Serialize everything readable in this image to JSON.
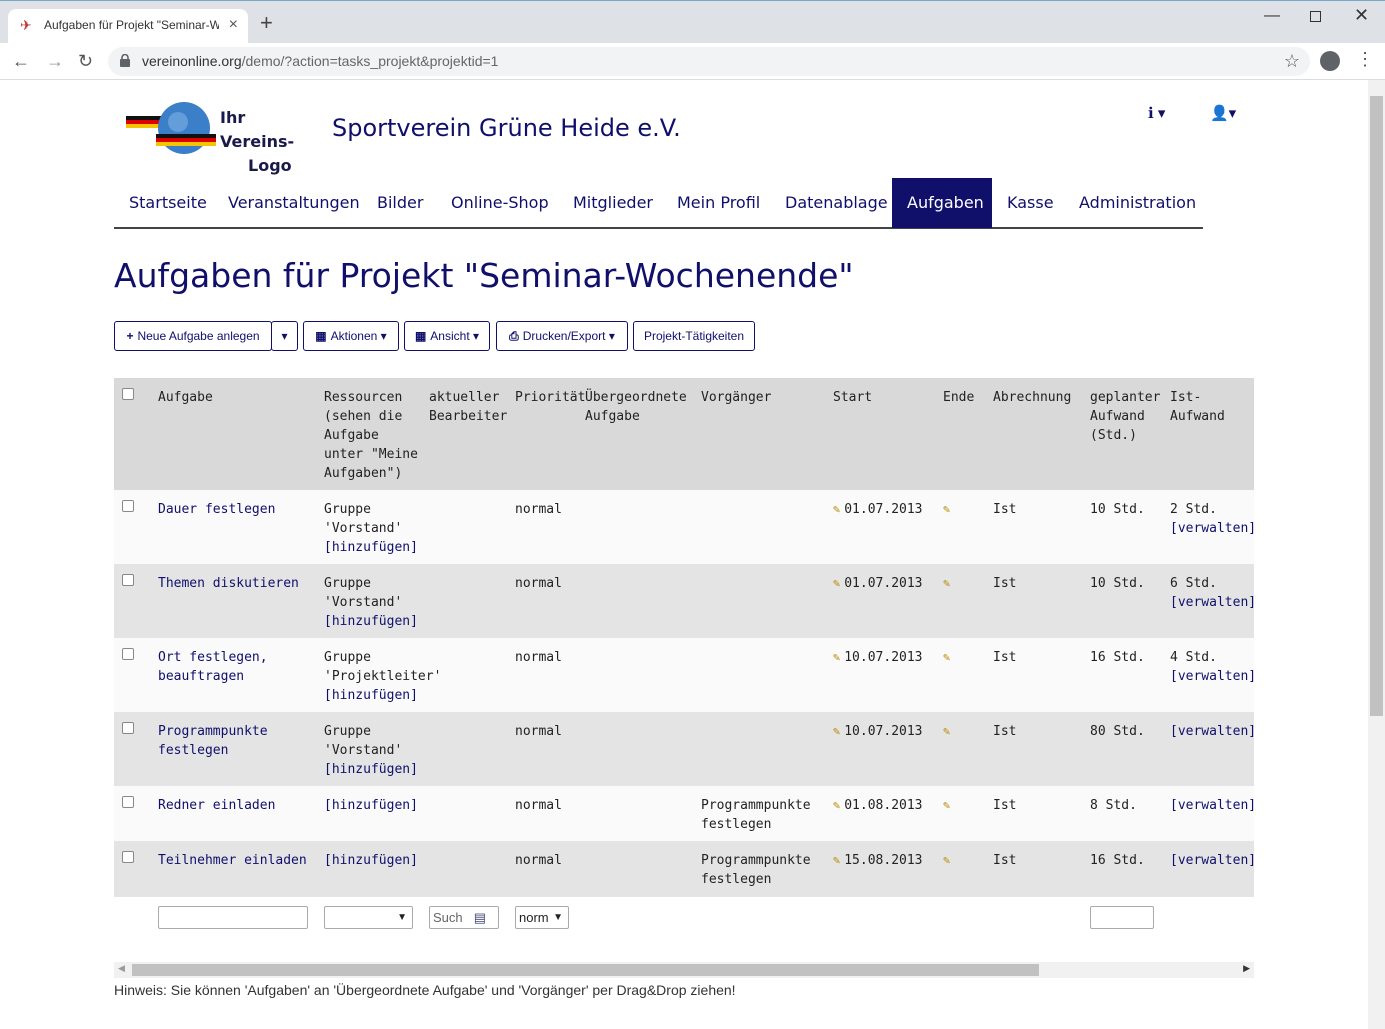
{
  "browser": {
    "tab_title": "Aufgaben für Projekt \"Seminar-W",
    "url_host": "vereinonline.org",
    "url_path": "/demo/?action=tasks_projekt&projektid=1"
  },
  "header": {
    "logo_line1": "Ihr Vereins-",
    "logo_line2": "Logo",
    "site_title": "Sportverein Grüne Heide e.V."
  },
  "nav": {
    "items": [
      "Startseite",
      "Veranstaltungen",
      "Bilder",
      "Online-Shop",
      "Mitglieder",
      "Mein Profil",
      "Datenablage",
      "Aufgaben",
      "Kasse",
      "Administration"
    ],
    "active": "Aufgaben"
  },
  "page": {
    "title": "Aufgaben für Projekt \"Seminar-Wochenende\""
  },
  "toolbar": {
    "new_task": "Neue Aufgabe anlegen",
    "actions": "Aktionen",
    "view": "Ansicht",
    "print": "Drucken/Export",
    "project_activities": "Projekt-Tätigkeiten"
  },
  "table": {
    "headers": {
      "task": "Aufgabe",
      "resources_1": "Ressourcen",
      "resources_2": "(sehen die",
      "resources_3": "Aufgabe",
      "resources_4": "unter \"Meine",
      "resources_5": "Aufgaben\")",
      "editor_1": "aktueller",
      "editor_2": "Bearbeiter",
      "priority": "Priorität",
      "parent_1": "Übergeordnete",
      "parent_2": "Aufgabe",
      "predecessor": "Vorgänger",
      "start": "Start",
      "end": "Ende",
      "billing": "Abrechnung",
      "planned_1": "geplanter",
      "planned_2": "Aufwand",
      "planned_3": "(Std.)",
      "actual_1": "Ist-",
      "actual_2": "Aufwand"
    },
    "rows": [
      {
        "task_1": "Dauer festlegen",
        "task_2": "",
        "res_1": "Gruppe",
        "res_2": "'Vorstand'",
        "res_add": "[hinzufügen]",
        "priority": "normal",
        "pred_1": "",
        "pred_2": "",
        "start": "01.07.2013",
        "billing": "Ist",
        "planned": "10 Std.",
        "actual": "2 Std.",
        "manage": "[verwalten]"
      },
      {
        "task_1": "Themen diskutieren",
        "task_2": "",
        "res_1": "Gruppe",
        "res_2": "'Vorstand'",
        "res_add": "[hinzufügen]",
        "priority": "normal",
        "pred_1": "",
        "pred_2": "",
        "start": "01.07.2013",
        "billing": "Ist",
        "planned": "10 Std.",
        "actual": "6 Std.",
        "manage": "[verwalten]"
      },
      {
        "task_1": "Ort festlegen,",
        "task_2": "beauftragen",
        "res_1": "Gruppe",
        "res_2": "'Projektleiter'",
        "res_add": "[hinzufügen]",
        "priority": "normal",
        "pred_1": "",
        "pred_2": "",
        "start": "10.07.2013",
        "billing": "Ist",
        "planned": "16 Std.",
        "actual": "4 Std.",
        "manage": "[verwalten]"
      },
      {
        "task_1": "Programmpunkte",
        "task_2": "festlegen",
        "res_1": "Gruppe",
        "res_2": "'Vorstand'",
        "res_add": "[hinzufügen]",
        "priority": "normal",
        "pred_1": "",
        "pred_2": "",
        "start": "10.07.2013",
        "billing": "Ist",
        "planned": "80 Std.",
        "actual": "",
        "manage": "[verwalten]"
      },
      {
        "task_1": "Redner einladen",
        "task_2": "",
        "res_1": "",
        "res_2": "",
        "res_add": "[hinzufügen]",
        "priority": "normal",
        "pred_1": "Programmpunkte",
        "pred_2": "festlegen",
        "start": "01.08.2013",
        "billing": "Ist",
        "planned": "8 Std.",
        "actual": "",
        "manage": "[verwalten]"
      },
      {
        "task_1": "Teilnehmer einladen",
        "task_2": "",
        "res_1": "",
        "res_2": "",
        "res_add": "[hinzufügen]",
        "priority": "normal",
        "pred_1": "Programmpunkte",
        "pred_2": "festlegen",
        "start": "15.08.2013",
        "billing": "Ist",
        "planned": "16 Std.",
        "actual": "",
        "manage": "[verwalten]"
      }
    ],
    "filters": {
      "editor_placeholder": "Such",
      "priority_value": "norm"
    }
  },
  "hint": "Hinweis: Sie können 'Aufgaben' an 'Übergeordnete Aufgabe' und 'Vorgänger' per Drag&Drop ziehen!"
}
